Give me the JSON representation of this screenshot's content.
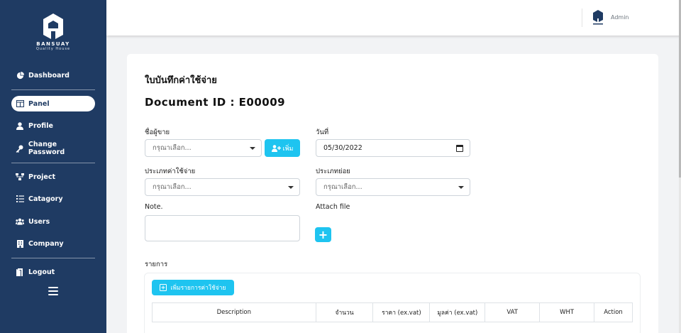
{
  "brand": {
    "name": "BANSUAY",
    "tagline": "Quality House"
  },
  "sidebar": {
    "items": [
      {
        "label": "Dashboard",
        "icon": "dashboard-icon"
      },
      {
        "label": "Panel",
        "icon": "panel-icon",
        "active": true
      },
      {
        "label": "Profile",
        "icon": "user-icon"
      },
      {
        "label": "Change Password",
        "icon": "key-icon"
      },
      {
        "label": "Project",
        "icon": "project-icon"
      },
      {
        "label": "Catagory",
        "icon": "list-icon"
      },
      {
        "label": "Users",
        "icon": "users-icon"
      },
      {
        "label": "Company",
        "icon": "building-icon"
      },
      {
        "label": "Logout",
        "icon": "logout-icon"
      }
    ]
  },
  "topbar": {
    "user": "Admin",
    "avatar_caption": "BANSUAY"
  },
  "form": {
    "title": "ใบบันทึกค่าใช้จ่าย",
    "document_id": "Document ID : E00009",
    "vendor": {
      "label": "ชื่อผู้ขาย",
      "placeholder": "กรุณาเลือก...",
      "add_button": "เพิ่ม"
    },
    "date": {
      "label": "วันที่",
      "value": "05/30/2022"
    },
    "expense_type": {
      "label": "ประเภทค่าใช้จ่าย",
      "placeholder": "กรุณาเลือก..."
    },
    "subtype": {
      "label": "ประเภทย่อย",
      "placeholder": "กรุณาเลือก..."
    },
    "note": {
      "label": "Note."
    },
    "attach": {
      "label": "Attach file",
      "button": "+"
    },
    "items_label": "รายการ",
    "add_item_button": "เพิ่มรายการค่าใช้จ่าย",
    "columns": [
      "Description",
      "จำนวน",
      "ราคา (ex.vat)",
      "มูลค่า (ex.vat)",
      "VAT",
      "WHT",
      "Action"
    ]
  },
  "colors": {
    "sidebar": "#1f3b63",
    "accent": "#1ec4f0",
    "background": "#f2f3f5"
  }
}
